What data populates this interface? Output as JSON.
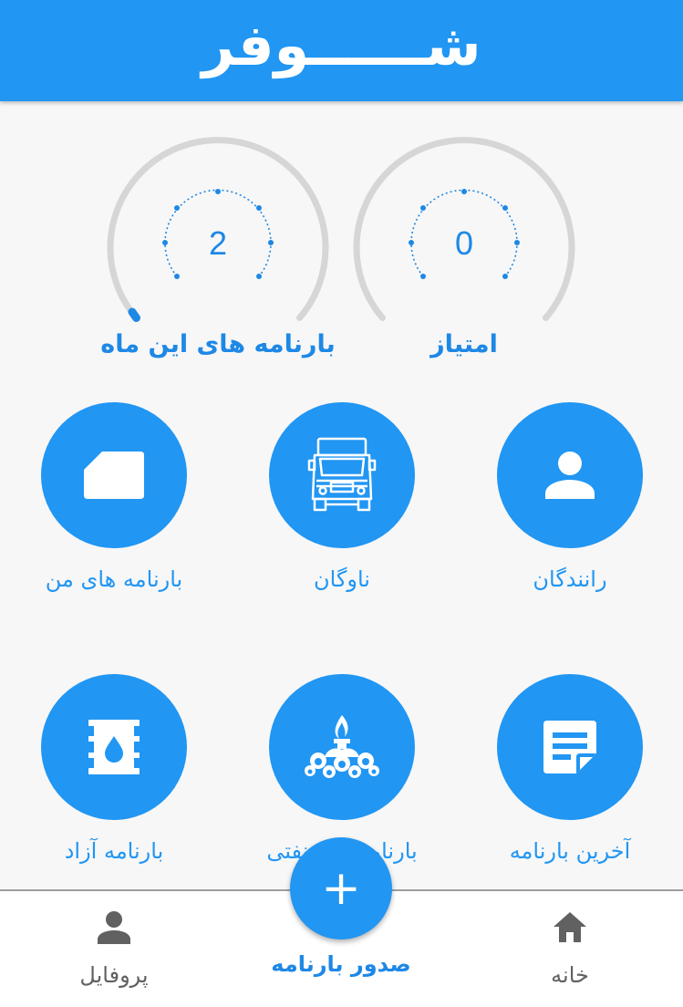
{
  "app": {
    "title": "شــــــوفر"
  },
  "gauges": [
    {
      "label": "امتیاز",
      "value": "0",
      "level": 0
    },
    {
      "label": "بارنامه های این ماه",
      "value": "2",
      "level": 0.02
    }
  ],
  "tiles": [
    {
      "label": "رانندگان",
      "icon": "person-icon"
    },
    {
      "label": "ناوگان",
      "icon": "truck-icon"
    },
    {
      "label": "بارنامه های من",
      "icon": "card-icon"
    },
    {
      "label": "آخرین بارنامه",
      "icon": "note-icon"
    },
    {
      "label": "بارنامه های نفتی",
      "icon": "oil-company-logo-icon"
    },
    {
      "label": "بارنامه آزاد",
      "icon": "oil-barrel-icon"
    }
  ],
  "fab": {
    "symbol": "+",
    "label": "صدور بارنامه"
  },
  "nav": {
    "home": "خانه",
    "profile": "پروفایل"
  },
  "colors": {
    "primary": "#2196f3",
    "gauge_track": "#d6d6d6",
    "nav_text": "#616161"
  }
}
